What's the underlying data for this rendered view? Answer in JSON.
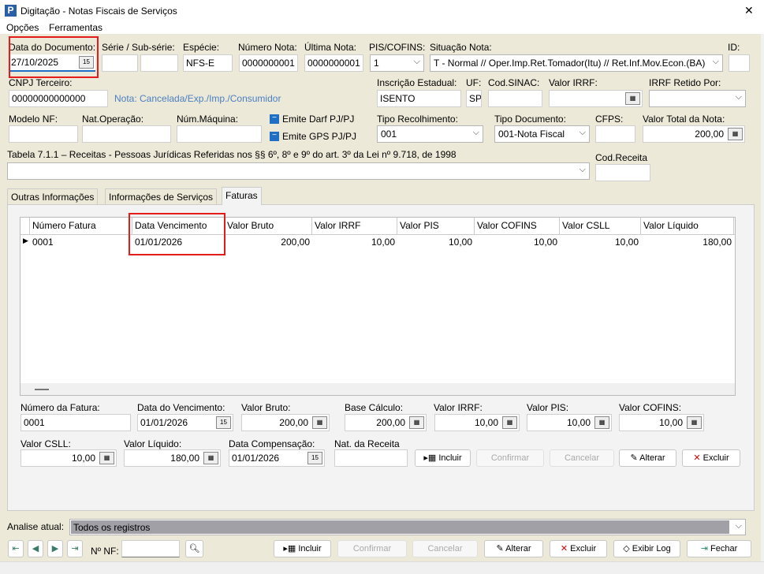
{
  "window": {
    "title": "Digitação - Notas Fiscais de Serviços",
    "close": "✕"
  },
  "menu": [
    "Opções",
    "Ferramentas"
  ],
  "header": {
    "data_documento": {
      "label": "Data do Documento:",
      "value": "27/10/2025"
    },
    "serie": {
      "label": "Série / Sub-série:",
      "value": "",
      "sub": ""
    },
    "especie": {
      "label": "Espécie:",
      "value": "NFS-E"
    },
    "numero_nota": {
      "label": "Número Nota:",
      "value": "0000000001"
    },
    "ultima_nota": {
      "label": "Última Nota:",
      "value": "0000000001"
    },
    "pis_cofins": {
      "label": "PIS/COFINS:",
      "value": "1"
    },
    "situacao": {
      "label": "Situação Nota:",
      "value": "T - Normal // Oper.Imp.Ret.Tomador(Itu) // Ret.Inf.Mov.Econ.(BA)"
    },
    "id": {
      "label": "ID:",
      "value": ""
    },
    "cnpj": {
      "label": "CNPJ Terceiro:",
      "value": "00000000000000"
    },
    "nota_info": "Nota: Cancelada/Exp./Imp./Consumidor",
    "ie": {
      "label": "Inscrição Estadual:",
      "value": "ISENTO"
    },
    "uf": {
      "label": "UF:",
      "value": "SP"
    },
    "sinac": {
      "label": "Cod.SINAC:",
      "value": ""
    },
    "irrf": {
      "label": "Valor IRRF:",
      "value": ""
    },
    "irrf_retido": {
      "label": "IRRF Retido Por:",
      "value": ""
    },
    "modelo": {
      "label": "Modelo NF:",
      "value": ""
    },
    "natop": {
      "label": "Nat.Operação:",
      "value": ""
    },
    "maquina": {
      "label": "Núm.Máquina:",
      "value": ""
    },
    "darf": "Emite Darf PJ/PJ",
    "gps": "Emite GPS PJ/PJ",
    "tipo_rec": {
      "label": "Tipo Recolhimento:",
      "value": "001"
    },
    "tipo_doc": {
      "label": "Tipo Documento:",
      "value": "001-Nota Fiscal"
    },
    "cfps": {
      "label": "CFPS:",
      "value": ""
    },
    "total": {
      "label": "Valor Total da Nota:",
      "value": "200,00"
    },
    "tabela": {
      "label": "Tabela 7.1.1 – Receitas - Pessoas Jurídicas Referidas nos §§ 6º, 8º e 9º do art. 3º da Lei nº 9.718, de 1998",
      "value": ""
    },
    "cod_receita": {
      "label": "Cod.Receita",
      "value": ""
    }
  },
  "tabs": [
    "Outras Informações",
    "Informações de Serviços",
    "Faturas"
  ],
  "grid": {
    "columns": [
      "Número Fatura",
      "Data Vencimento",
      "Valor Bruto",
      "Valor IRRF",
      "Valor PIS",
      "Valor COFINS",
      "Valor CSLL",
      "Valor Líquido"
    ],
    "rows": [
      [
        "0001",
        "01/01/2026",
        "200,00",
        "10,00",
        "10,00",
        "10,00",
        "10,00",
        "180,00"
      ]
    ]
  },
  "fatura": {
    "numero": {
      "label": "Número da Fatura:",
      "value": "0001"
    },
    "vencimento": {
      "label": "Data do Vencimento:",
      "value": "01/01/2026"
    },
    "bruto": {
      "label": "Valor Bruto:",
      "value": "200,00"
    },
    "base": {
      "label": "Base Cálculo:",
      "value": "200,00"
    },
    "irrf": {
      "label": "Valor IRRF:",
      "value": "10,00"
    },
    "pis": {
      "label": "Valor PIS:",
      "value": "10,00"
    },
    "cofins": {
      "label": "Valor COFINS:",
      "value": "10,00"
    },
    "csll": {
      "label": "Valor CSLL:",
      "value": "10,00"
    },
    "liquido": {
      "label": "Valor Líquido:",
      "value": "180,00"
    },
    "compensacao": {
      "label": "Data Compensação:",
      "value": "01/01/2026"
    },
    "nat_receita": {
      "label": "Nat. da Receita",
      "value": ""
    },
    "buttons": [
      "Incluir",
      "Confirmar",
      "Cancelar",
      "Alterar",
      "Excluir"
    ]
  },
  "analise": {
    "label": "Analise atual:",
    "value": "Todos os registros"
  },
  "footer": {
    "nf_label": "Nº NF:",
    "nf_value": "",
    "buttons": [
      "Incluir",
      "Confirmar",
      "Cancelar",
      "Alterar",
      "Excluir",
      "Exibir Log",
      "Fechar"
    ]
  }
}
